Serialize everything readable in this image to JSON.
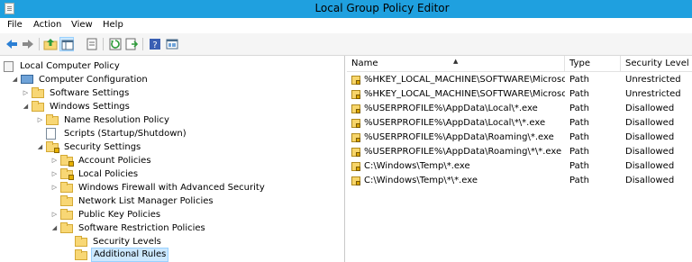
{
  "window": {
    "title": "Local Group Policy Editor"
  },
  "menu": [
    "File",
    "Action",
    "View",
    "Help"
  ],
  "toolbar": [
    {
      "name": "back-icon"
    },
    {
      "name": "forward-icon"
    },
    {
      "name": "up-folder-icon"
    },
    {
      "name": "show-hide-console-tree-icon"
    },
    {
      "name": "properties-icon"
    },
    {
      "name": "refresh-icon"
    },
    {
      "name": "export-list-icon"
    },
    {
      "name": "help-icon"
    },
    {
      "name": "extended-view-icon"
    }
  ],
  "tree": [
    {
      "label": "Local Computer Policy",
      "level": 0,
      "expander": "",
      "icon": "policy"
    },
    {
      "label": "Computer Configuration",
      "level": 1,
      "expander": "open",
      "icon": "computer"
    },
    {
      "label": "Software Settings",
      "level": 2,
      "expander": "closed",
      "icon": "folder"
    },
    {
      "label": "Windows Settings",
      "level": 2,
      "expander": "open",
      "icon": "folder"
    },
    {
      "label": "Name Resolution Policy",
      "level": 3,
      "expander": "closed",
      "icon": "folder"
    },
    {
      "label": "Scripts (Startup/Shutdown)",
      "level": 3,
      "expander": "",
      "icon": "doc"
    },
    {
      "label": "Security Settings",
      "level": 3,
      "expander": "open",
      "icon": "lockfolder"
    },
    {
      "label": "Account Policies",
      "level": 4,
      "expander": "closed",
      "icon": "lockfolder"
    },
    {
      "label": "Local Policies",
      "level": 4,
      "expander": "closed",
      "icon": "lockfolder"
    },
    {
      "label": "Windows Firewall with Advanced Security",
      "level": 4,
      "expander": "closed",
      "icon": "folder"
    },
    {
      "label": "Network List Manager Policies",
      "level": 4,
      "expander": "",
      "icon": "folder"
    },
    {
      "label": "Public Key Policies",
      "level": 4,
      "expander": "closed",
      "icon": "folder"
    },
    {
      "label": "Software Restriction Policies",
      "level": 4,
      "expander": "open",
      "icon": "folder"
    },
    {
      "label": "Security Levels",
      "level": 5,
      "expander": "",
      "icon": "folder"
    },
    {
      "label": "Additional Rules",
      "level": 5,
      "expander": "",
      "icon": "folder",
      "selected": true
    }
  ],
  "list": {
    "columns": [
      "Name",
      "Type",
      "Security Level"
    ],
    "rows": [
      {
        "name": "%HKEY_LOCAL_MACHINE\\SOFTWARE\\Microsof...",
        "type": "Path",
        "level": "Unrestricted"
      },
      {
        "name": "%HKEY_LOCAL_MACHINE\\SOFTWARE\\Microsof...",
        "type": "Path",
        "level": "Unrestricted"
      },
      {
        "name": "%USERPROFILE%\\AppData\\Local\\*.exe",
        "type": "Path",
        "level": "Disallowed"
      },
      {
        "name": "%USERPROFILE%\\AppData\\Local\\*\\*.exe",
        "type": "Path",
        "level": "Disallowed"
      },
      {
        "name": "%USERPROFILE%\\AppData\\Roaming\\*.exe",
        "type": "Path",
        "level": "Disallowed"
      },
      {
        "name": "%USERPROFILE%\\AppData\\Roaming\\*\\*.exe",
        "type": "Path",
        "level": "Disallowed"
      },
      {
        "name": "C:\\Windows\\Temp\\*.exe",
        "type": "Path",
        "level": "Disallowed"
      },
      {
        "name": "C:\\Windows\\Temp\\*\\*.exe",
        "type": "Path",
        "level": "Disallowed"
      }
    ]
  },
  "colors": {
    "titlebar": "#1fa0df",
    "selection": "#cce8ff",
    "selection_border": "#99d1ff"
  }
}
